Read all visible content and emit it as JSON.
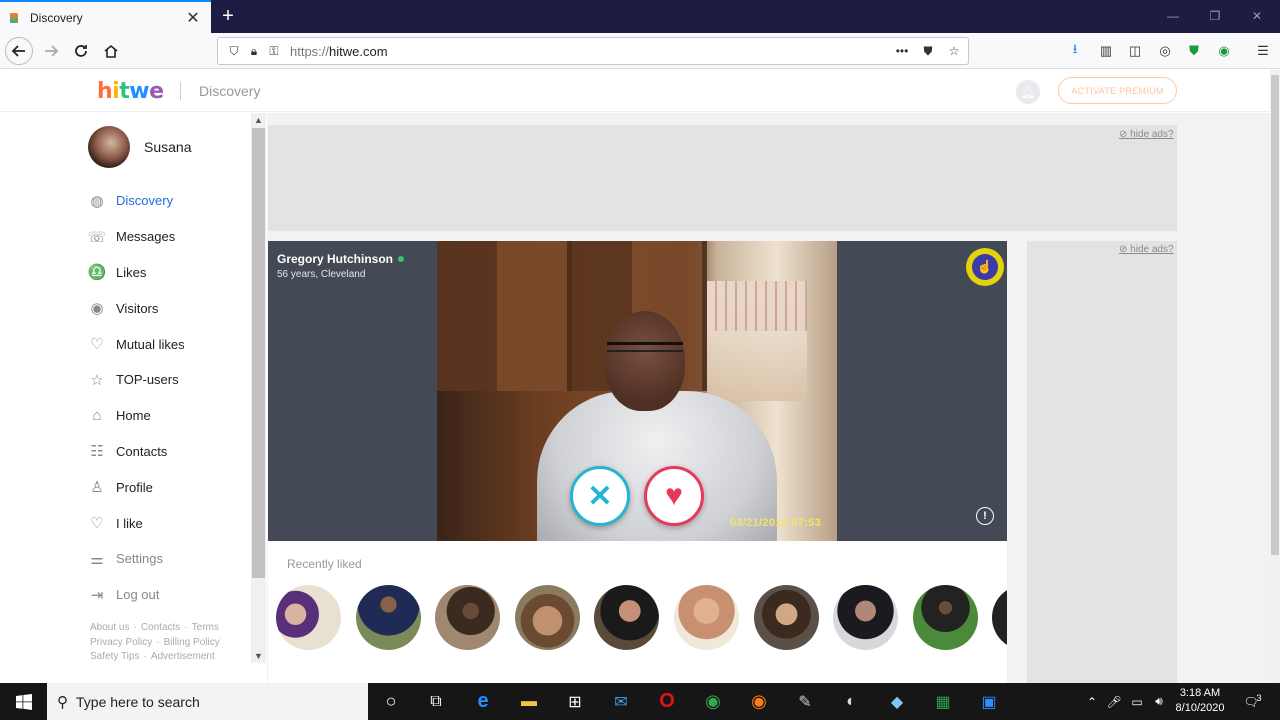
{
  "browser": {
    "tab_title": "Discovery",
    "tab_close": "✕",
    "new_tab": "+",
    "url_protocol": "https://",
    "url_host": "hitwe.com",
    "window_controls": [
      "—",
      "❐",
      "✕"
    ]
  },
  "site": {
    "logo": [
      "h",
      "i",
      "t",
      "w",
      "e"
    ],
    "section": "Discovery",
    "premium_button": "ACTIVATE PREMIUM",
    "hide_ads": "hide ads?"
  },
  "sidebar": {
    "user_name": "Susana",
    "items": [
      {
        "label": "Discovery",
        "icon": "globe-icon",
        "glyph": "◍"
      },
      {
        "label": "Messages",
        "icon": "chat-icon",
        "glyph": "☏"
      },
      {
        "label": "Likes",
        "icon": "bell-icon",
        "glyph": "♎"
      },
      {
        "label": "Visitors",
        "icon": "eye-icon",
        "glyph": "◉"
      },
      {
        "label": "Mutual likes",
        "icon": "heart-pulse-icon",
        "glyph": "♡"
      },
      {
        "label": "TOP-users",
        "icon": "star-icon",
        "glyph": "☆"
      },
      {
        "label": "Home",
        "icon": "home-icon",
        "glyph": "⌂"
      },
      {
        "label": "Contacts",
        "icon": "contacts-icon",
        "glyph": "☷"
      },
      {
        "label": "Profile",
        "icon": "person-icon",
        "glyph": "♙"
      },
      {
        "label": "I like",
        "icon": "heart-icon",
        "glyph": "♡"
      },
      {
        "label": "Settings",
        "icon": "sliders-icon",
        "glyph": "⚌"
      },
      {
        "label": "Log out",
        "icon": "logout-icon",
        "glyph": "⇥"
      }
    ],
    "footer_links": [
      "About us",
      "·",
      "Contacts",
      "·",
      "Terms",
      "Privacy Policy",
      "·",
      "Billing Policy",
      "Safety Tips",
      "·",
      "Advertisement"
    ]
  },
  "card": {
    "name": "Gregory Hutchinson",
    "meta": "56 years, Cleveland",
    "photo_timestamp": "03/21/2013 07:53",
    "dislike_glyph": "✕",
    "like_glyph": "♥",
    "info_glyph": "!"
  },
  "recent": {
    "title": "Recently liked"
  },
  "taskbar": {
    "search_placeholder": "Type here to search",
    "time": "3:18 AM",
    "date": "8/10/2020",
    "notification_count": "3"
  },
  "colors": {
    "accent": "#1e6fd9",
    "dislike": "#24b4d4",
    "like": "#e8395a",
    "premium": "#ffc2a0"
  }
}
